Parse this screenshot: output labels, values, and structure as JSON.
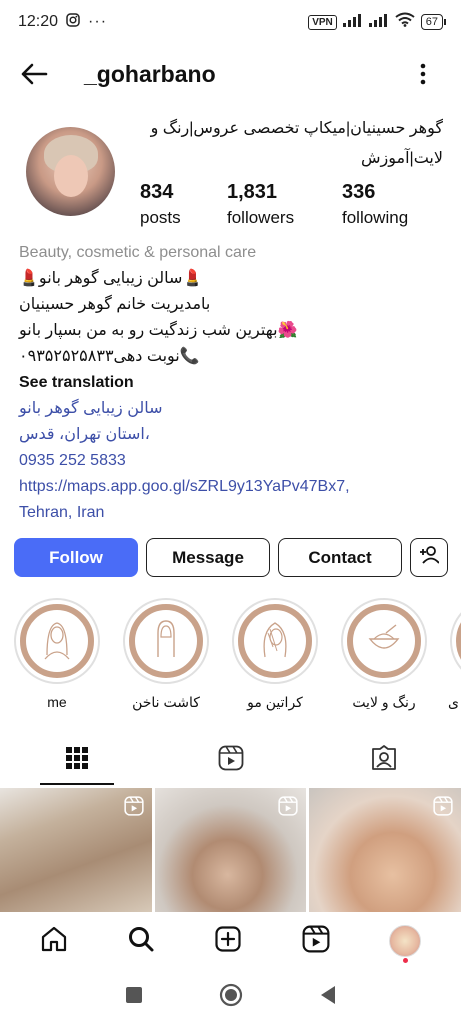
{
  "status_bar": {
    "time": "12:20",
    "vpn": "VPN",
    "battery": "67"
  },
  "header": {
    "username": "_goharbano"
  },
  "profile": {
    "title_line": "گوهر حسینیان|میکاپ تخصصی عروس|رنگ و لایت|آموزش",
    "stats": [
      {
        "value": "834",
        "label": "posts"
      },
      {
        "value": "1,831",
        "label": "followers"
      },
      {
        "value": "336",
        "label": "following"
      }
    ]
  },
  "bio": {
    "category": "Beauty, cosmetic & personal care",
    "line1": "💄سالن زیبایی گوهر بانو💄",
    "line2": "بامدیریت خانم گوهر حسینیان",
    "line3": "🌺بهترین شب زندگیت رو به من بسپار بانو",
    "line4": "📞نوبت دهی۰۹۳۵۲۵۲۵۸۳۳",
    "see_translation": "See translation",
    "business_name": "سالن زیبایی گوهر بانو",
    "address": "،استان تهران، قدس",
    "phone": "0935 252 5833",
    "maps_link": "https://maps.app.goo.gl/sZRL9y13YaPv47Bx7,",
    "city": "Tehran, Iran"
  },
  "actions": {
    "follow": "Follow",
    "message": "Message",
    "contact": "Contact"
  },
  "highlights": [
    {
      "label": "me",
      "icon": "woman-portrait-icon"
    },
    {
      "label": "کاشت ناخن",
      "icon": "nail-icon"
    },
    {
      "label": "کراتین مو",
      "icon": "hair-icon"
    },
    {
      "label": "رنگ و لایت",
      "icon": "bowl-icon"
    },
    {
      "label": "ی",
      "icon": "partial-icon"
    }
  ],
  "tabs": [
    "grid-icon",
    "reels-icon",
    "tagged-icon"
  ],
  "colors": {
    "follow_button": "#4a6cf7",
    "link": "#3d4fa8",
    "category": "#8e8e8e",
    "highlight_ring": "#c9a28a"
  }
}
